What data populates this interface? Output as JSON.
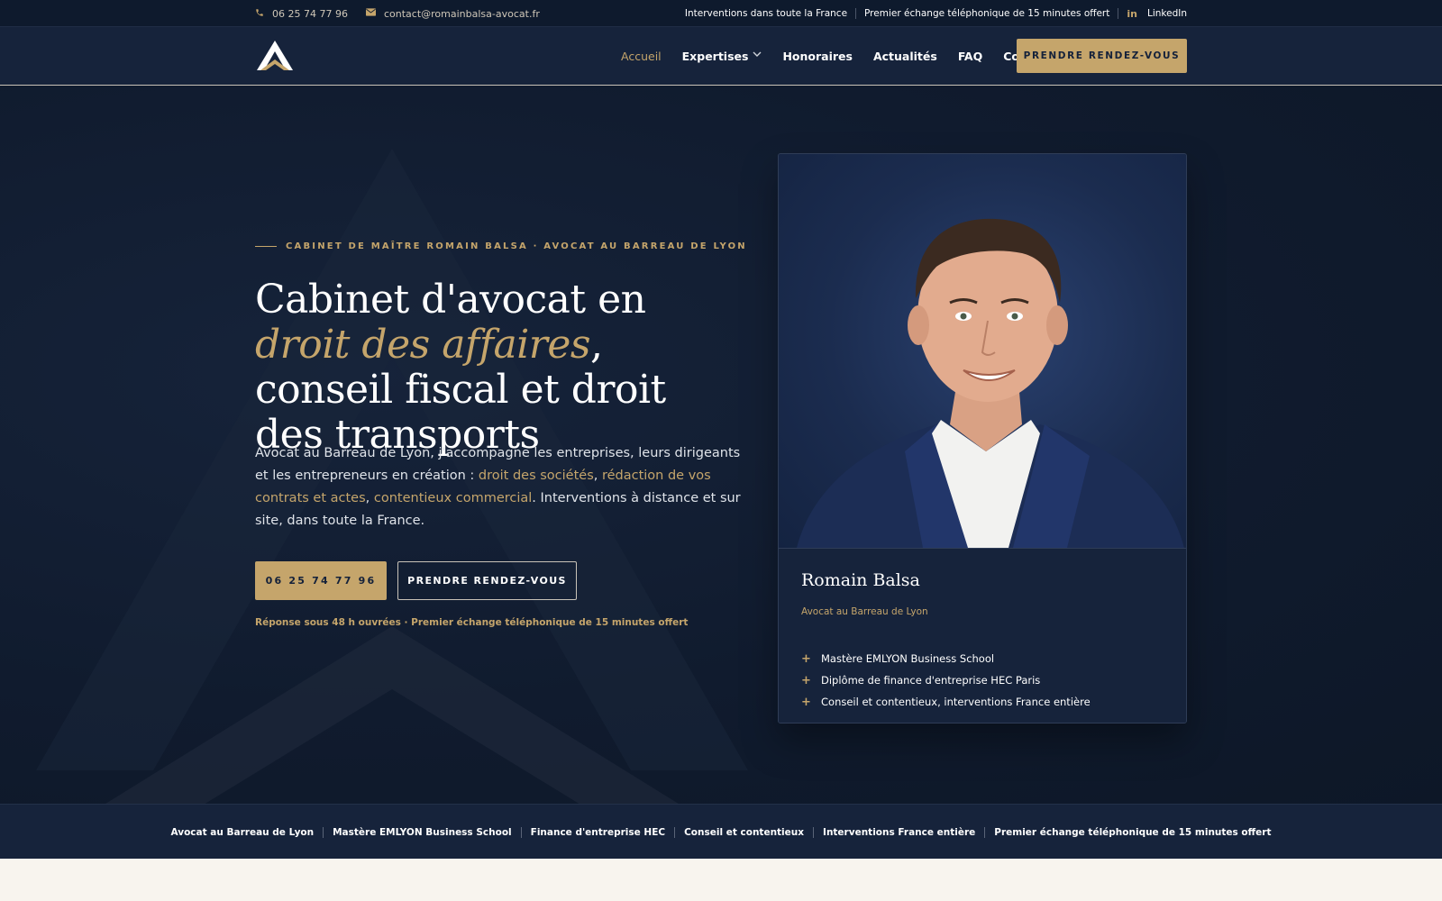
{
  "topbar": {
    "phone": "06 25 74 77 96",
    "email": "contact@romainbalsa-avocat.fr",
    "right_items": [
      "Interventions dans toute la France",
      "Premier échange téléphonique de 15 minutes offert"
    ],
    "linkedin_icon_text": "in",
    "linkedin_label": "LinkedIn"
  },
  "nav": {
    "links": [
      {
        "label": "Accueil",
        "active": true
      },
      {
        "label": "Expertises",
        "dropdown": true
      },
      {
        "label": "Honoraires"
      },
      {
        "label": "Actualités"
      },
      {
        "label": "FAQ"
      },
      {
        "label": "Contact"
      }
    ],
    "cta": "PRENDRE RENDEZ-VOUS"
  },
  "hero": {
    "eyebrow": "CABINET DE MAÎTRE ROMAIN BALSA · AVOCAT AU BARREAU DE LYON",
    "headline": {
      "part1": "Cabinet d'avocat en ",
      "highlight": "droit des affaires",
      "part2": ", conseil fiscal et droit des transports"
    },
    "intro": {
      "text1": "Avocat au Barreau de Lyon, j'accompagne les entreprises, leurs dirigeants et les entrepreneurs en création : ",
      "hl1": "droit des sociétés",
      "sep1": ", ",
      "hl2": "rédaction de vos contrats et actes",
      "sep2": ", ",
      "hl3": "contentieux commercial",
      "text2": ". Interventions à distance et sur site, dans toute la France."
    },
    "btn_phone": "06 25 74 77 96",
    "btn_rdv": "PRENDRE RENDEZ-VOUS",
    "note": "Réponse sous 48 h ouvrées · Premier échange téléphonique de 15 minutes offert"
  },
  "profile": {
    "name": "Romain Balsa",
    "role": "Avocat au Barreau de Lyon",
    "credentials": [
      "Mastère EMLYON Business School",
      "Diplôme de finance d'entreprise HEC Paris",
      "Conseil et contentieux, interventions France entière"
    ]
  },
  "credentials_bar": [
    "Avocat au Barreau de Lyon",
    "Mastère EMLYON Business School",
    "Finance d'entreprise HEC",
    "Conseil et contentieux",
    "Interventions France entière",
    "Premier échange téléphonique de 15 minutes offert"
  ],
  "colors": {
    "navy": "#16233b",
    "gold": "#c5a56b",
    "cream": "#f8f4ee"
  },
  "icons": {
    "phone": "phone-icon",
    "email": "envelope-icon",
    "linkedin": "linkedin-icon",
    "dropdown": "chevron-down-icon",
    "bullet": "plus-icon"
  }
}
